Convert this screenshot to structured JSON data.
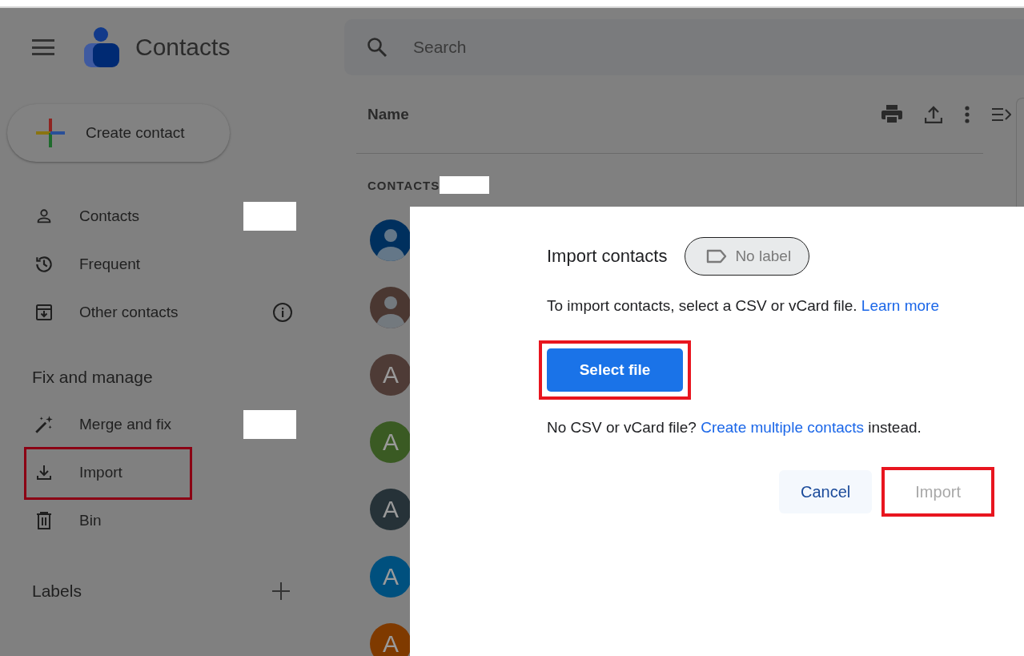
{
  "app": {
    "title": "Contacts"
  },
  "search": {
    "placeholder": "Search"
  },
  "create_button": {
    "label": "Create contact"
  },
  "sidebar": {
    "sections": [
      {
        "items": [
          {
            "label": "Contacts",
            "info": false,
            "redacted": true,
            "highlighted": false
          },
          {
            "label": "Frequent",
            "info": false,
            "redacted": false,
            "highlighted": false
          },
          {
            "label": "Other contacts",
            "info": true,
            "redacted": false,
            "highlighted": false
          }
        ]
      },
      {
        "heading": "Fix and manage",
        "items": [
          {
            "label": "Merge and fix",
            "info": false,
            "redacted": true,
            "highlighted": false
          },
          {
            "label": "Import",
            "info": false,
            "redacted": false,
            "highlighted": true
          },
          {
            "label": "Bin",
            "info": false,
            "redacted": false,
            "highlighted": false
          }
        ]
      }
    ],
    "labels": {
      "heading": "Labels"
    }
  },
  "list": {
    "column": "Name",
    "section": "CONTACTS",
    "section_redacted": true,
    "avatars": [
      {
        "kind": "photo",
        "color": "#00305e"
      },
      {
        "kind": "photo",
        "color": "#4a3731"
      },
      {
        "kind": "letter",
        "letter": "A",
        "color": "#4e3b36"
      },
      {
        "kind": "letter",
        "letter": "A",
        "color": "#3a5a23"
      },
      {
        "kind": "letter",
        "letter": "A",
        "color": "#263238"
      },
      {
        "kind": "letter",
        "letter": "A",
        "color": "#00507e"
      },
      {
        "kind": "letter",
        "letter": "A",
        "color": "#7f3a00"
      }
    ]
  },
  "dialog": {
    "title": "Import contacts",
    "label_chip": "No label",
    "text": "To import contacts, select a CSV or vCard file.",
    "link": "Learn more",
    "select_button": {
      "label": "Select file",
      "highlighted": true
    },
    "alt_before": "No CSV or vCard file?",
    "alt_link": "Create multiple contacts",
    "alt_after": "instead.",
    "buttons": [
      {
        "label": "Cancel",
        "kind": "tonal",
        "disabled": false,
        "highlighted": false
      },
      {
        "label": "Import",
        "kind": "text",
        "disabled": true,
        "highlighted": true
      }
    ]
  }
}
